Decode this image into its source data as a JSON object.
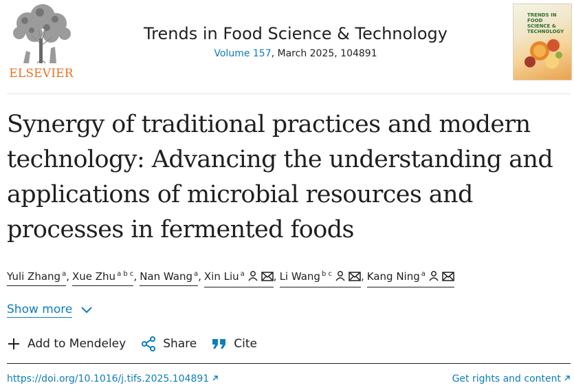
{
  "header": {
    "publisher_logo_text": "ELSEVIER",
    "journal_title": "Trends in Food Science & Technology",
    "volume_link": "Volume 157",
    "issue_info": ", March 2025, 104891",
    "cover_text": "TRENDS IN FOOD SCIENCE & TECHNOLOGY"
  },
  "article": {
    "title": "Synergy of traditional practices and modern technology: Advancing the understanding and applications of microbial resources and processes in fermented foods"
  },
  "authors": [
    {
      "name": "Yuli Zhang",
      "affil": "a",
      "icons": []
    },
    {
      "name": "Xue Zhu",
      "affil": "a b c",
      "icons": []
    },
    {
      "name": "Nan Wang",
      "affil": "a",
      "icons": []
    },
    {
      "name": "Xin Liu",
      "affil": "a",
      "icons": [
        "person-icon",
        "mail-icon"
      ]
    },
    {
      "name": "Li Wang",
      "affil": "b c",
      "icons": [
        "person-icon",
        "mail-icon"
      ]
    },
    {
      "name": "Kang Ning",
      "affil": "a",
      "icons": [
        "person-icon",
        "mail-icon"
      ]
    }
  ],
  "show_more": "Show more",
  "actions": {
    "mendeley": "Add to Mendeley",
    "share": "Share",
    "cite": "Cite"
  },
  "footer": {
    "doi": "https://doi.org/10.1016/j.tifs.2025.104891",
    "rights": "Get rights and content"
  },
  "colors": {
    "link": "#0c7dbb",
    "elsevier_orange": "#e9711c",
    "text": "#1f1f1f"
  }
}
